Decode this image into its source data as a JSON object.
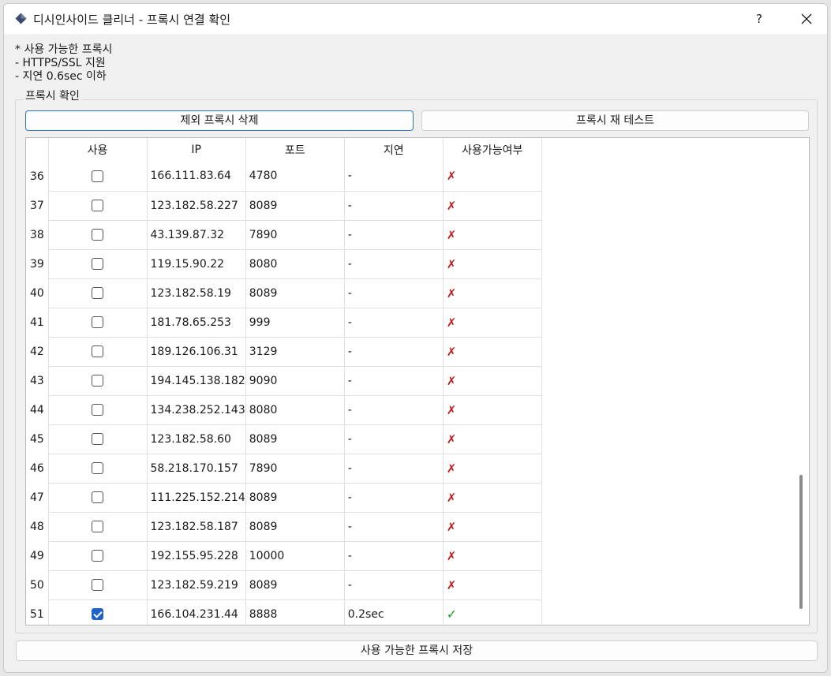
{
  "window": {
    "title": "디시인사이드 클리너 - 프록시 연결 확인",
    "help_label": "?"
  },
  "info": {
    "lines": [
      "* 사용 가능한 프록시",
      "- HTTPS/SSL 지원",
      "- 지연 0.6sec 이하"
    ]
  },
  "group": {
    "label": "프록시 확인",
    "delete_button": "제외 프록시 삭제",
    "retest_button": "프록시 재 테스트"
  },
  "table": {
    "columns": [
      "사용",
      "IP",
      "포트",
      "지연",
      "사용가능여부"
    ],
    "rows": [
      {
        "num": "36",
        "checked": false,
        "ip": "166.111.83.64",
        "port": "4780",
        "latency": "-",
        "ok": false
      },
      {
        "num": "37",
        "checked": false,
        "ip": "123.182.58.227",
        "port": "8089",
        "latency": "-",
        "ok": false
      },
      {
        "num": "38",
        "checked": false,
        "ip": "43.139.87.32",
        "port": "7890",
        "latency": "-",
        "ok": false
      },
      {
        "num": "39",
        "checked": false,
        "ip": "119.15.90.22",
        "port": "8080",
        "latency": "-",
        "ok": false
      },
      {
        "num": "40",
        "checked": false,
        "ip": "123.182.58.19",
        "port": "8089",
        "latency": "-",
        "ok": false
      },
      {
        "num": "41",
        "checked": false,
        "ip": "181.78.65.253",
        "port": "999",
        "latency": "-",
        "ok": false
      },
      {
        "num": "42",
        "checked": false,
        "ip": "189.126.106.31",
        "port": "3129",
        "latency": "-",
        "ok": false
      },
      {
        "num": "43",
        "checked": false,
        "ip": "194.145.138.182",
        "port": "9090",
        "latency": "-",
        "ok": false
      },
      {
        "num": "44",
        "checked": false,
        "ip": "134.238.252.143",
        "port": "8080",
        "latency": "-",
        "ok": false
      },
      {
        "num": "45",
        "checked": false,
        "ip": "123.182.58.60",
        "port": "8089",
        "latency": "-",
        "ok": false
      },
      {
        "num": "46",
        "checked": false,
        "ip": "58.218.170.157",
        "port": "7890",
        "latency": "-",
        "ok": false
      },
      {
        "num": "47",
        "checked": false,
        "ip": "111.225.152.214",
        "port": "8089",
        "latency": "-",
        "ok": false
      },
      {
        "num": "48",
        "checked": false,
        "ip": "123.182.58.187",
        "port": "8089",
        "latency": "-",
        "ok": false
      },
      {
        "num": "49",
        "checked": false,
        "ip": "192.155.95.228",
        "port": "10000",
        "latency": "-",
        "ok": false
      },
      {
        "num": "50",
        "checked": false,
        "ip": "123.182.59.219",
        "port": "8089",
        "latency": "-",
        "ok": false
      },
      {
        "num": "51",
        "checked": true,
        "ip": "166.104.231.44",
        "port": "8888",
        "latency": "0.2sec",
        "ok": true
      }
    ],
    "fail_mark": "✗",
    "ok_mark": "✓",
    "fail_color": "#c21c1c",
    "ok_color": "#19a319"
  },
  "footer": {
    "save_button": "사용 가능한 프록시 저장"
  }
}
